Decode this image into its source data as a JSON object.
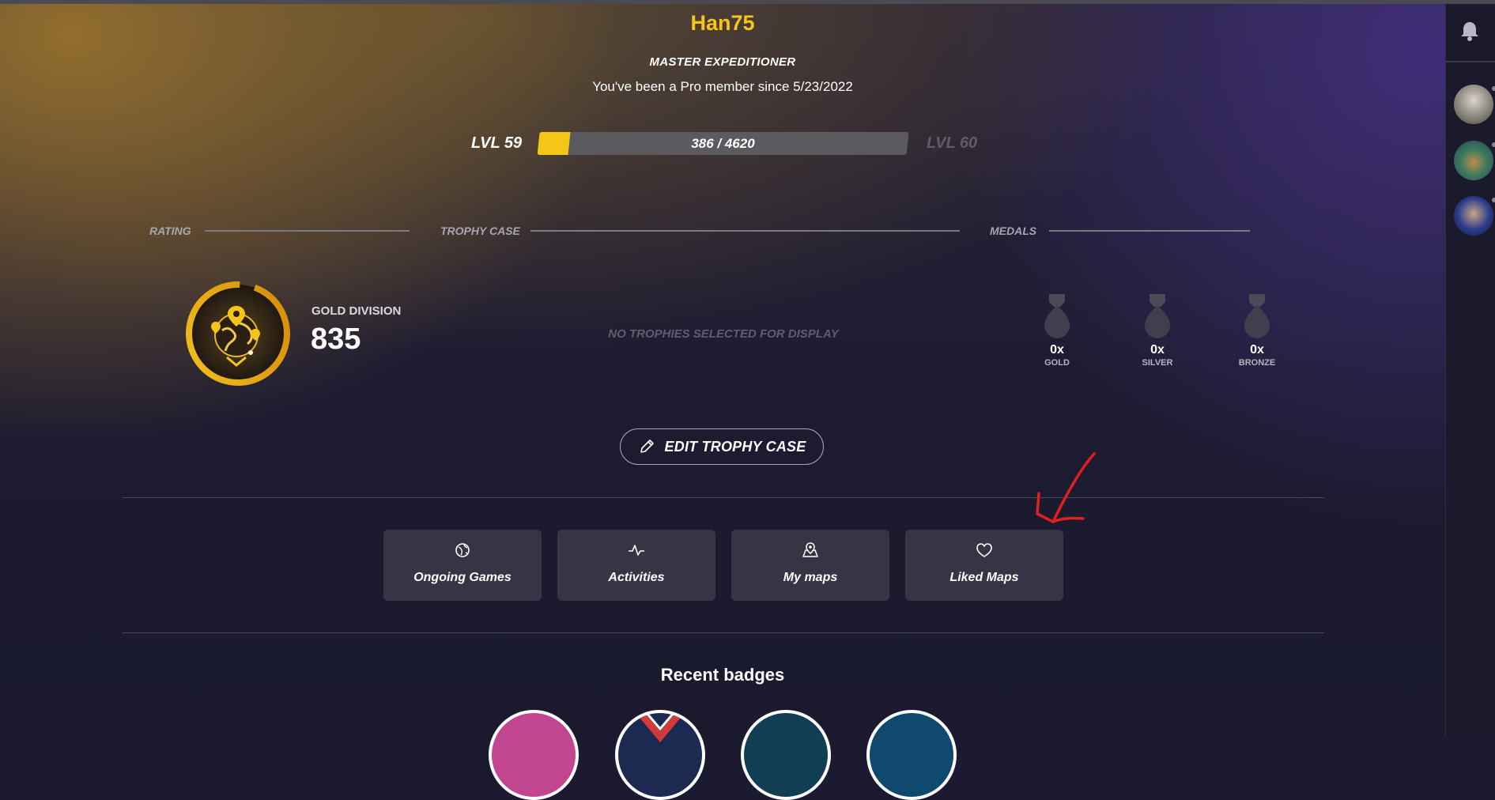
{
  "profile": {
    "username": "Han75",
    "title": "MASTER EXPEDITIONER",
    "member_since": "You've been a Pro member since 5/23/2022"
  },
  "level": {
    "current_label": "LVL 59",
    "next_label": "LVL 60",
    "xp_text": "386 / 4620",
    "xp_progress_fraction": 0.0835
  },
  "sections": {
    "rating": "RATING",
    "trophy_case": "TROPHY CASE",
    "medals": "MEDALS"
  },
  "rating": {
    "division": "GOLD DIVISION",
    "value": "835"
  },
  "trophy_case": {
    "empty_text": "NO TROPHIES SELECTED FOR DISPLAY",
    "edit_button": "EDIT TROPHY CASE"
  },
  "medals": [
    {
      "count": "0x",
      "type": "GOLD"
    },
    {
      "count": "0x",
      "type": "SILVER"
    },
    {
      "count": "0x",
      "type": "BRONZE"
    }
  ],
  "nav_tiles": [
    {
      "label": "Ongoing Games",
      "icon": "globe-icon"
    },
    {
      "label": "Activities",
      "icon": "activity-pulse-icon"
    },
    {
      "label": "My maps",
      "icon": "map-pin-icon"
    },
    {
      "label": "Liked Maps",
      "icon": "heart-icon"
    }
  ],
  "recent_badges": {
    "title": "Recent badges",
    "badge_colors": [
      "#c2458f",
      "#1c2a52",
      "#123e54",
      "#0f4a6e"
    ]
  },
  "sidebar": {
    "icons": [
      "bell-icon"
    ],
    "friends": [
      "friend-avatar-1",
      "friend-avatar-2",
      "friend-avatar-3"
    ]
  },
  "colors": {
    "accent_gold": "#f5c518",
    "tile_bg": "#363546",
    "annotation_red": "#e0201c"
  }
}
